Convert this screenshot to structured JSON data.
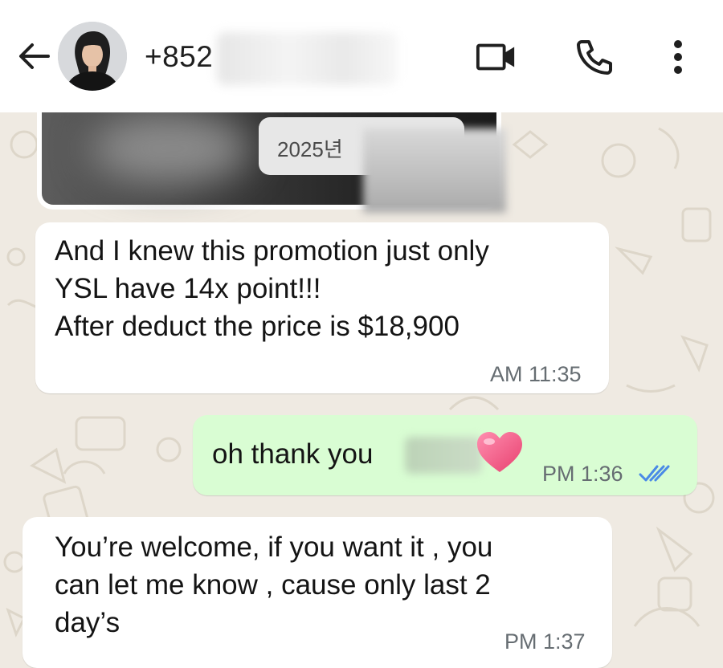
{
  "header": {
    "back_icon": "arrow-left-icon",
    "contact_phone": "+852",
    "video_icon": "video-camera-icon",
    "call_icon": "phone-icon",
    "menu_icon": "more-vertical-icon"
  },
  "chat": {
    "date_label": "2025년",
    "messages": [
      {
        "direction": "incoming",
        "text": "And I knew this promotion just only\nYSL have 14x point!!!\nAfter deduct the price is $18,900",
        "time": "AM 11:35"
      },
      {
        "direction": "outgoing",
        "text": "oh thank you",
        "emoji": "heart",
        "time": "PM 1:36",
        "status_icon": "double-check-icon"
      },
      {
        "direction": "incoming",
        "text": "You’re welcome, if you want it , you\ncan let me know , cause only last 2\nday’s",
        "time": "PM 1:37"
      }
    ]
  },
  "colors": {
    "incoming_bubble": "#ffffff",
    "outgoing_bubble": "#d9fdd3",
    "chat_background": "#efeae2",
    "read_tick": "#4a8ae6"
  }
}
